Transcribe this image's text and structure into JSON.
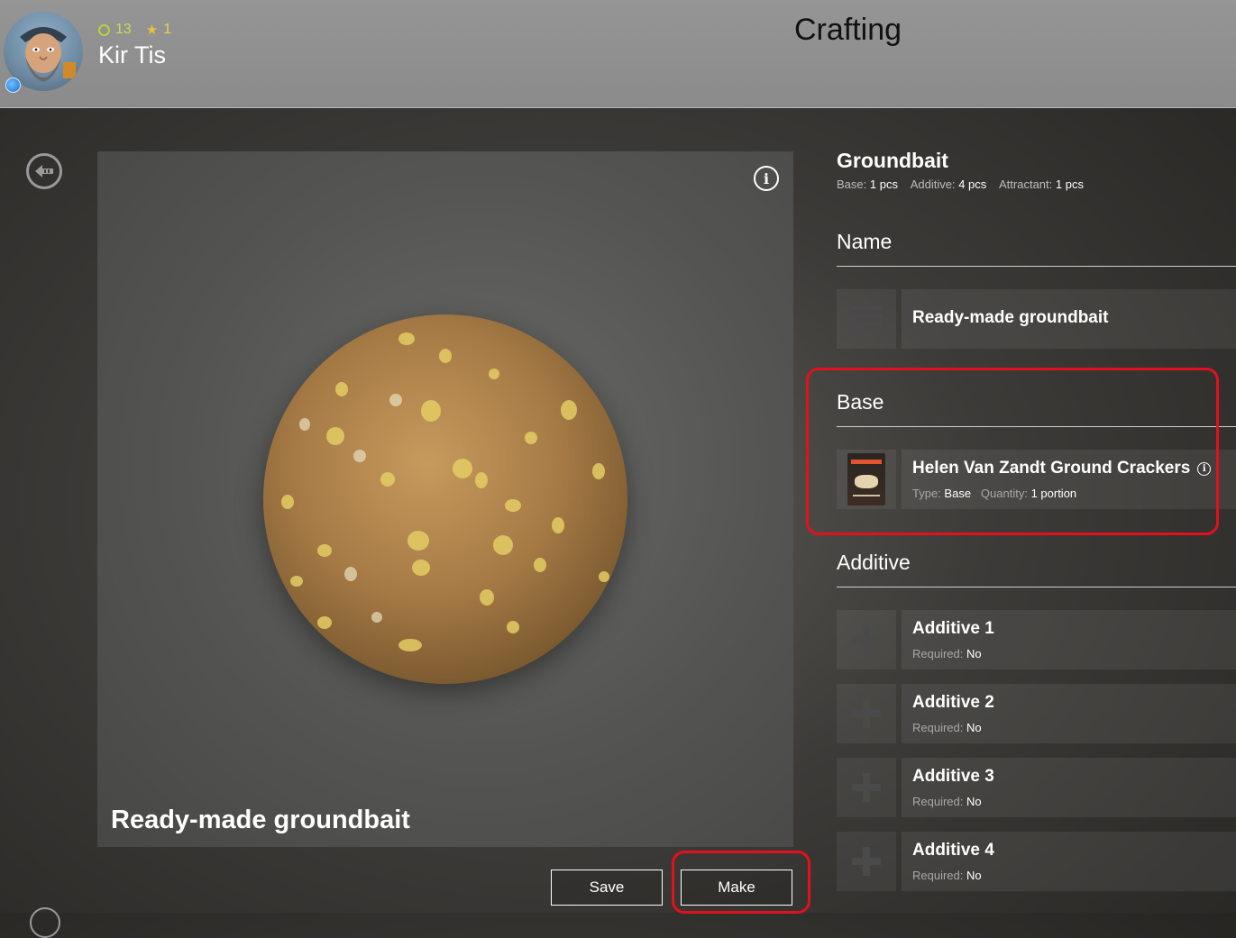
{
  "header": {
    "level": "13",
    "stars": "1",
    "player_name": "Kir Tis",
    "title": "Crafting"
  },
  "preview": {
    "caption": "Ready-made groundbait",
    "info_icon": "i"
  },
  "actions": {
    "save_label": "Save",
    "make_label": "Make"
  },
  "recipe": {
    "title": "Groundbait",
    "summary": {
      "base_label": "Base:",
      "base_value": "1 pcs",
      "additive_label": "Additive:",
      "additive_value": "4 pcs",
      "attractant_label": "Attractant:",
      "attractant_value": "1 pcs"
    }
  },
  "name_section": {
    "heading": "Name",
    "value": "Ready-made groundbait"
  },
  "base_section": {
    "heading": "Base",
    "item": {
      "title": "Helen Van Zandt Ground Crackers",
      "type_label": "Type:",
      "type_value": "Base",
      "quantity_label": "Quantity:",
      "quantity_value": "1 portion"
    }
  },
  "additive_section": {
    "heading": "Additive",
    "slots": [
      {
        "title": "Additive 1",
        "required_label": "Required:",
        "required_value": "No"
      },
      {
        "title": "Additive 2",
        "required_label": "Required:",
        "required_value": "No"
      },
      {
        "title": "Additive 3",
        "required_label": "Required:",
        "required_value": "No"
      },
      {
        "title": "Additive 4",
        "required_label": "Required:",
        "required_value": "No"
      }
    ]
  },
  "icons": [
    "back-arrow-icon",
    "info-icon",
    "menu-lines-icon",
    "plus-icon",
    "globe-icon",
    "star-icon",
    "level-ring-icon"
  ],
  "colors": {
    "highlight": "#e3101e",
    "level": "#c9dc52",
    "star": "#e8c23a",
    "title": "#111111"
  }
}
